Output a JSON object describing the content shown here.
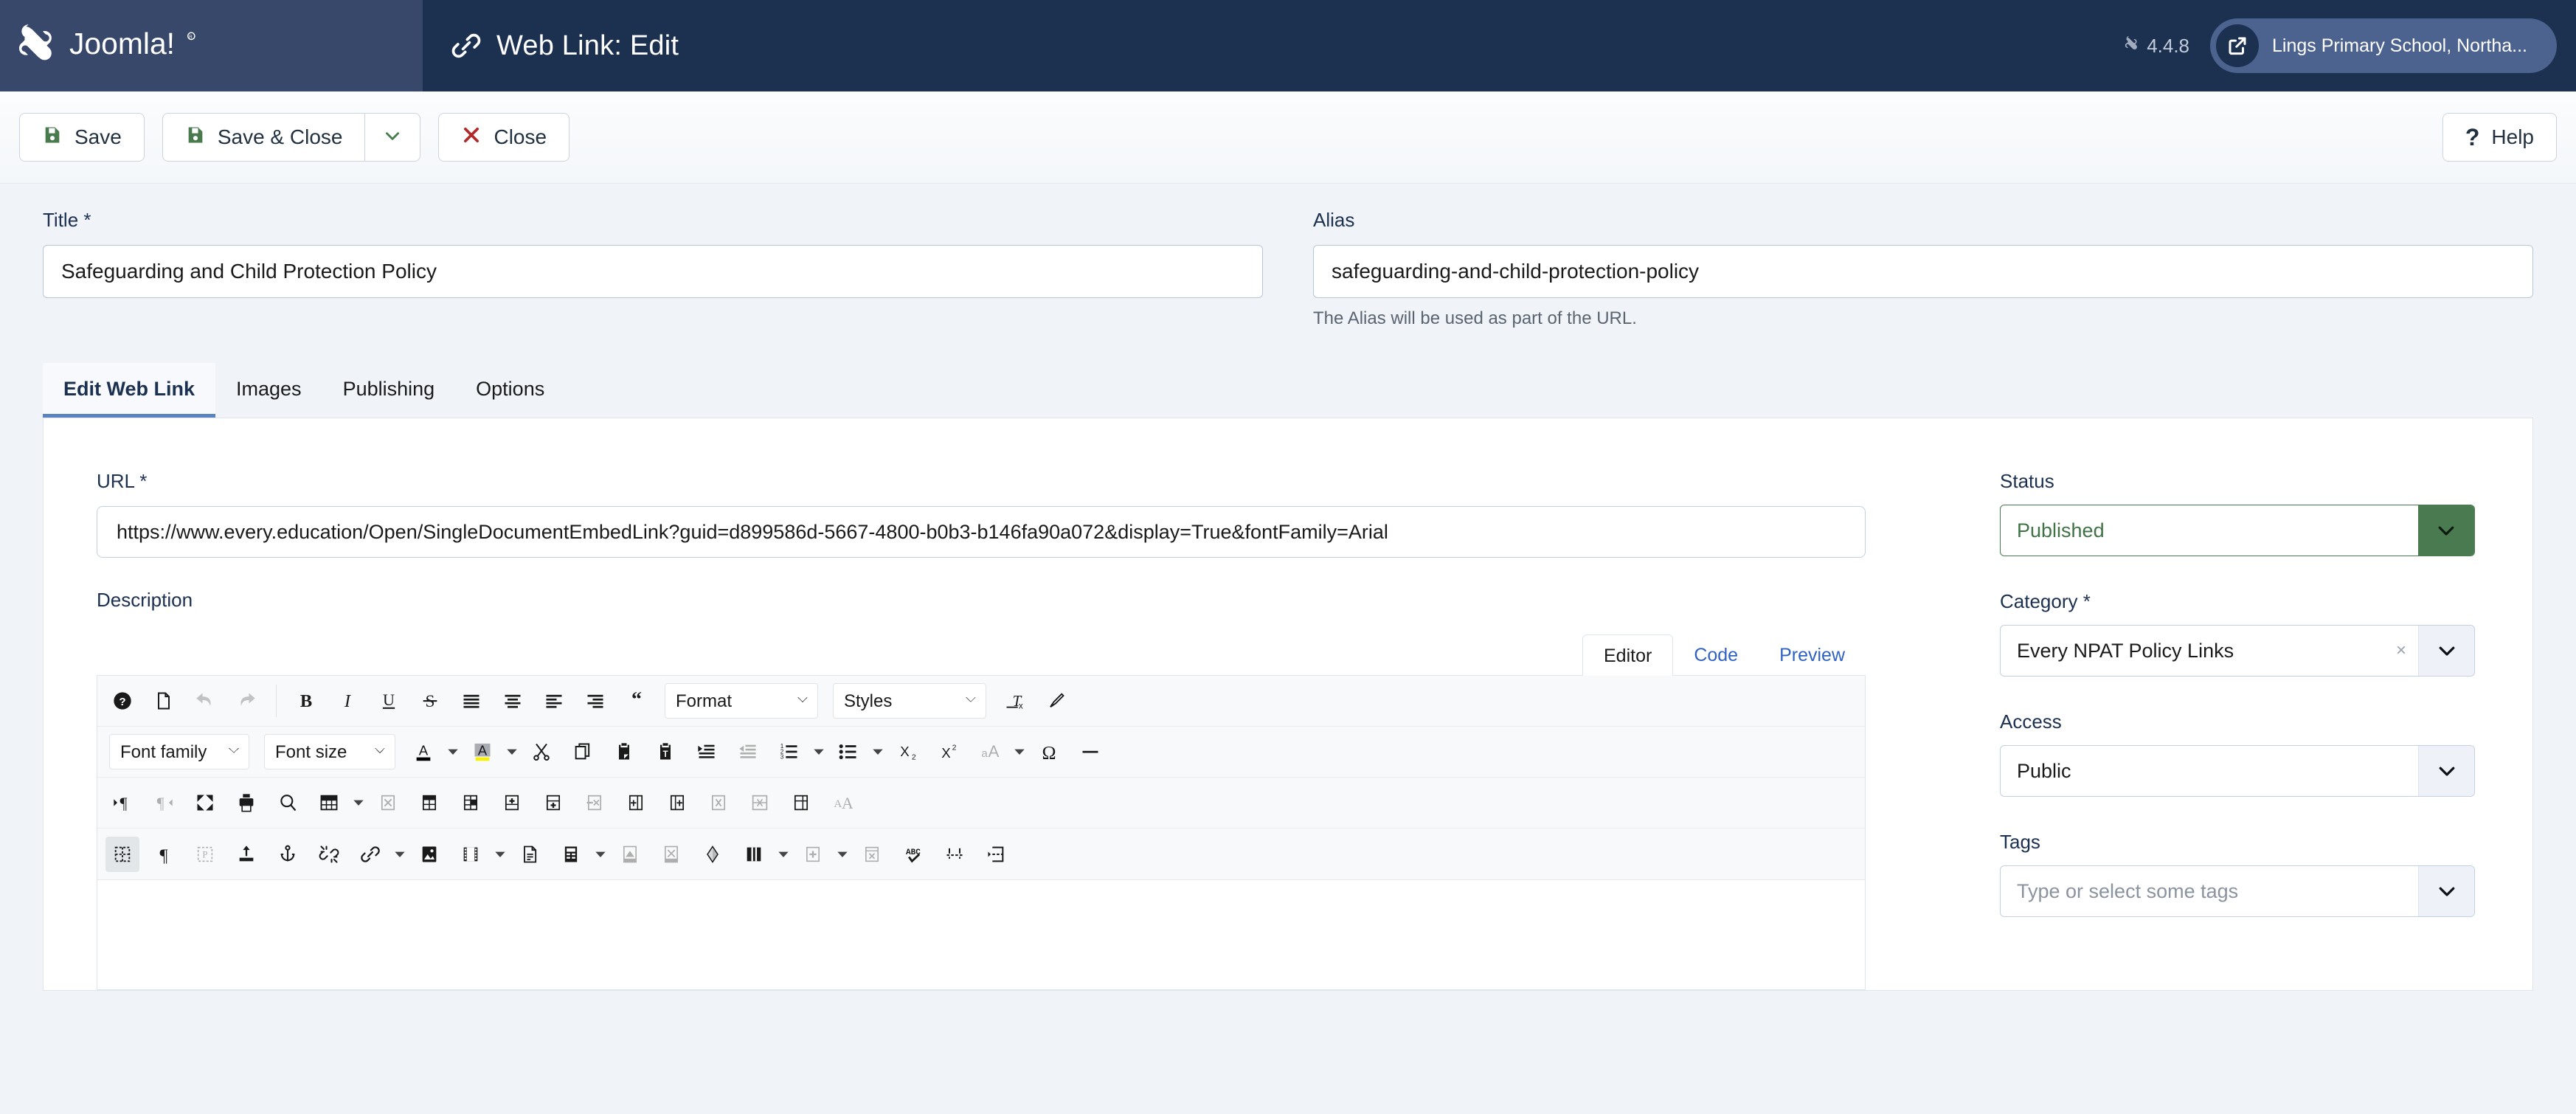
{
  "header": {
    "brand_name": "Joomla!",
    "brand_mark": "joomla-logo",
    "page_title": "Web Link: Edit",
    "page_title_icon": "link-icon",
    "version": "4.4.8",
    "version_icon": "joomla-small-icon",
    "site_name": "Lings Primary School, Northa...",
    "site_icon": "external-link-icon",
    "colors": {
      "brand_bg": "#38486b",
      "header_bg": "#1c3050",
      "pill_bg": "#4c628f",
      "accent": "#5b83c0"
    }
  },
  "toolbar": {
    "save_label": "Save",
    "save_icon": "floppy-disk-icon",
    "save_close_label": "Save & Close",
    "save_close_icon": "floppy-disk-icon",
    "save_dropdown_icon": "chevron-down-icon",
    "close_label": "Close",
    "close_icon": "x-icon",
    "help_label": "Help",
    "help_icon": "question-mark-icon"
  },
  "top_fields": {
    "title": {
      "label": "Title",
      "required_marker": "*",
      "value": "Safeguarding and Child Protection Policy",
      "placeholder": ""
    },
    "alias": {
      "label": "Alias",
      "value": "safeguarding-and-child-protection-policy",
      "placeholder": "",
      "help": "The Alias will be used as part of the URL."
    }
  },
  "tabs": [
    {
      "label": "Edit Web Link",
      "active": true
    },
    {
      "label": "Images",
      "active": false
    },
    {
      "label": "Publishing",
      "active": false
    },
    {
      "label": "Options",
      "active": false
    }
  ],
  "main": {
    "url": {
      "label": "URL",
      "required_marker": "*",
      "value": "https://www.every.education/Open/SingleDocumentEmbedLink?guid=d899586d-5667-4800-b0b3-b146fa90a072&display=True&fontFamily=Arial",
      "placeholder": ""
    },
    "description": {
      "label": "Description",
      "editor_tabs": [
        {
          "label": "Editor",
          "active": true
        },
        {
          "label": "Code",
          "active": false
        },
        {
          "label": "Preview",
          "active": false
        }
      ],
      "body_value": "",
      "editor_toolbar": {
        "row1": [
          {
            "icon": "help-circle-icon",
            "dim": false
          },
          {
            "icon": "new-document-icon",
            "dim": false
          },
          {
            "icon": "undo-icon",
            "dim": true
          },
          {
            "icon": "redo-icon",
            "dim": true
          },
          {
            "icon": "separator",
            "dim": false
          },
          {
            "icon": "bold-icon",
            "dim": false
          },
          {
            "icon": "italic-icon",
            "dim": false
          },
          {
            "icon": "underline-icon",
            "dim": false
          },
          {
            "icon": "strikethrough-icon",
            "dim": false
          },
          {
            "icon": "align-justify-icon",
            "dim": false
          },
          {
            "icon": "align-center-icon",
            "dim": false
          },
          {
            "icon": "align-left-icon",
            "dim": false
          },
          {
            "icon": "align-right-icon",
            "dim": false
          },
          {
            "icon": "blockquote-icon",
            "dim": false
          },
          {
            "icon": "format-select",
            "dim": false
          },
          {
            "icon": "styles-select",
            "dim": false
          },
          {
            "icon": "clear-formatting-icon",
            "dim": false
          },
          {
            "icon": "paintbrush-icon",
            "dim": false
          }
        ],
        "format_select_label": "Format",
        "styles_select_label": "Styles",
        "font_family_label": "Font family",
        "font_size_label": "Font size",
        "row2": [
          {
            "icon": "text-color-icon",
            "dim": false
          },
          {
            "icon": "chevron-down-icon",
            "dim": false
          },
          {
            "icon": "highlight-color-icon",
            "dim": false
          },
          {
            "icon": "chevron-down-icon",
            "dim": false
          },
          {
            "icon": "cut-scissors-icon",
            "dim": false
          },
          {
            "icon": "copy-icon",
            "dim": false
          },
          {
            "icon": "paste-icon",
            "dim": false
          },
          {
            "icon": "paste-as-text-icon",
            "dim": false
          },
          {
            "icon": "indent-increase-icon",
            "dim": false
          },
          {
            "icon": "indent-decrease-icon",
            "dim": true
          },
          {
            "icon": "ordered-list-icon",
            "dim": false
          },
          {
            "icon": "chevron-down-icon",
            "dim": false
          },
          {
            "icon": "unordered-list-icon",
            "dim": false
          },
          {
            "icon": "chevron-down-icon",
            "dim": false
          },
          {
            "icon": "subscript-icon",
            "dim": false
          },
          {
            "icon": "superscript-icon",
            "dim": false
          },
          {
            "icon": "font-case-icon",
            "dim": true
          },
          {
            "icon": "chevron-down-icon",
            "dim": false
          },
          {
            "icon": "special-character-icon",
            "dim": false
          },
          {
            "icon": "horizontal-rule-icon",
            "dim": false
          }
        ],
        "row3": [
          {
            "icon": "ltr-direction-icon",
            "dim": false
          },
          {
            "icon": "rtl-direction-icon",
            "dim": true
          },
          {
            "icon": "fullscreen-icon",
            "dim": false
          },
          {
            "icon": "print-icon",
            "dim": false
          },
          {
            "icon": "search-replace-icon",
            "dim": false
          },
          {
            "icon": "insert-table-icon",
            "dim": false
          },
          {
            "icon": "chevron-down-icon",
            "dim": false
          },
          {
            "icon": "delete-table-icon",
            "dim": true
          },
          {
            "icon": "table-properties-icon",
            "dim": false
          },
          {
            "icon": "cell-properties-icon",
            "dim": false
          },
          {
            "icon": "insert-row-above-icon",
            "dim": false
          },
          {
            "icon": "insert-row-below-icon",
            "dim": false
          },
          {
            "icon": "delete-row-icon",
            "dim": true
          },
          {
            "icon": "insert-column-before-icon",
            "dim": false
          },
          {
            "icon": "insert-column-after-icon",
            "dim": false
          },
          {
            "icon": "delete-column-icon",
            "dim": true
          },
          {
            "icon": "merge-cells-icon",
            "dim": true
          },
          {
            "icon": "split-cell-icon",
            "dim": false
          },
          {
            "icon": "font-size-decrease-icon",
            "dim": true
          }
        ],
        "row4": [
          {
            "icon": "visual-blocks-icon",
            "dim": false,
            "active": true
          },
          {
            "icon": "show-invisibles-icon",
            "dim": false
          },
          {
            "icon": "visual-chars-icon",
            "dim": true
          },
          {
            "icon": "insert-file-icon",
            "dim": false
          },
          {
            "icon": "anchor-icon",
            "dim": false
          },
          {
            "icon": "unlink-icon",
            "dim": false
          },
          {
            "icon": "link-icon",
            "dim": false
          },
          {
            "icon": "chevron-down-icon",
            "dim": false
          },
          {
            "icon": "insert-image-icon",
            "dim": false
          },
          {
            "icon": "insert-media-icon",
            "dim": false
          },
          {
            "icon": "chevron-down-icon",
            "dim": false
          },
          {
            "icon": "page-break-icon",
            "dim": false
          },
          {
            "icon": "template-icon",
            "dim": false
          },
          {
            "icon": "chevron-down-icon",
            "dim": false
          },
          {
            "icon": "insert-layer-icon",
            "dim": true
          },
          {
            "icon": "remove-layer-icon",
            "dim": true
          },
          {
            "icon": "shape-icon",
            "dim": false
          },
          {
            "icon": "columns-icon",
            "dim": false
          },
          {
            "icon": "chevron-down-icon",
            "dim": false
          },
          {
            "icon": "add-column-icon",
            "dim": true
          },
          {
            "icon": "chevron-down-icon",
            "dim": false
          },
          {
            "icon": "remove-column-icon",
            "dim": true
          },
          {
            "icon": "spellcheck-icon",
            "dim": false
          },
          {
            "icon": "read-more-icon",
            "dim": false
          },
          {
            "icon": "page-break-2-icon",
            "dim": false
          }
        ]
      }
    }
  },
  "sidebar": {
    "status": {
      "label": "Status",
      "value": "Published",
      "arrow_icon": "chevron-down-icon",
      "accent": "#4a7a50"
    },
    "category": {
      "label": "Category",
      "required_marker": "*",
      "value": "Every NPAT Policy Links",
      "clear_icon": "x-icon",
      "clear_label": "×",
      "arrow_icon": "chevron-down-icon"
    },
    "access": {
      "label": "Access",
      "value": "Public",
      "arrow_icon": "chevron-down-icon"
    },
    "tags": {
      "label": "Tags",
      "value": "",
      "placeholder": "Type or select some tags",
      "arrow_icon": "chevron-down-icon"
    }
  }
}
